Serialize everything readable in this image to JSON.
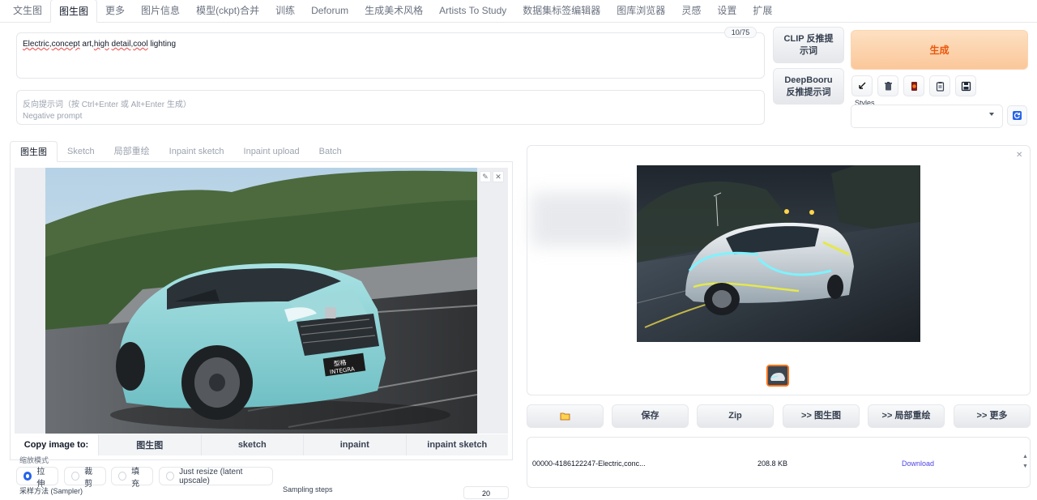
{
  "nav": {
    "tabs": [
      "文生图",
      "图生图",
      "更多",
      "图片信息",
      "模型(ckpt)合并",
      "训练",
      "Deforum",
      "生成美术风格",
      "Artists To Study",
      "数据集标签编辑器",
      "图库浏览器",
      "灵感",
      "设置",
      "扩展"
    ],
    "active": "图生图"
  },
  "prompt": {
    "w1": "Electric",
    "sep1": ",",
    "w2": "concept",
    "sp1": " art,",
    "w3": "high",
    "sp2": " ",
    "w4": "detail",
    "sep2": ",",
    "w5": "cool",
    "tail": " lighting",
    "token_count": "10/75"
  },
  "negative_prompt": {
    "label": "反向提示词（按 Ctrl+Enter 或 Alt+Enter 生成）",
    "placeholder": "Negative prompt"
  },
  "buttons": {
    "clip_line1": "CLIP 反推提",
    "clip_line2": "示词",
    "deepbooru_line1": "DeepBooru",
    "deepbooru_line2": "反推提示词",
    "generate": "生成"
  },
  "tools": [
    "arrow-icon",
    "trash-icon",
    "card-icon",
    "clipboard-icon",
    "save-icon"
  ],
  "styles": {
    "label": "Styles",
    "value": ""
  },
  "subtabs": {
    "items": [
      "图生图",
      "Sketch",
      "局部重绘",
      "Inpaint sketch",
      "Inpaint upload",
      "Batch"
    ],
    "active": "图生图"
  },
  "input_image": {
    "plate_line1": "型格",
    "plate_line2": "INTEGRA"
  },
  "copy_to": {
    "label": "Copy image to:",
    "targets": [
      "图生图",
      "sketch",
      "inpaint",
      "inpaint sketch"
    ]
  },
  "resize_mode": {
    "label": "缩放模式",
    "options": [
      "拉伸",
      "裁剪",
      "填充",
      "Just resize (latent upscale)"
    ],
    "selected": "拉伸"
  },
  "sampler": {
    "label": "采样方法 (Sampler)"
  },
  "steps": {
    "label": "Sampling steps",
    "value": "20"
  },
  "output_actions": [
    "folder-icon",
    "保存",
    "Zip",
    ">> 图生图",
    ">> 局部重绘",
    ">> 更多"
  ],
  "file": {
    "name": "00000-4186122247-Electric,conc...",
    "size": "208.8 KB",
    "download": "Download"
  },
  "colors": {
    "accent": "#ea580c",
    "generate_bg": "#fbc79a",
    "car_body": "#8fd3d6",
    "neon": "#e5e84a",
    "glow": "#7df3ff"
  }
}
